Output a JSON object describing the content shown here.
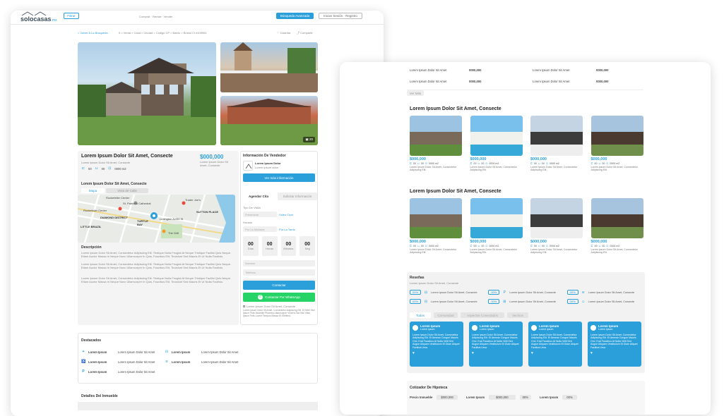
{
  "colors": {
    "accent": "#2b9fd9",
    "whatsapp": "#25d366",
    "background": "#ffffff"
  },
  "left": {
    "header": {
      "logo": "solocasas",
      "logo_suffix": ".mx",
      "filter_label": "Filtrar",
      "nav_links": "Comprar · Rentar · Vender",
      "advanced_search": "Búsqueda Avanzada",
      "login": "Iniciar Sesión - Registro"
    },
    "subnav": {
      "back": "< Volver A La Búsqueda",
      "breadcrumb": "0 > Venta > Casa > Ciudad > Código CP > Barrio > Bristol Ct #105981",
      "save": "Guardar",
      "share": "Compartir"
    },
    "photo_count": "20",
    "listing": {
      "title": "Lorem Ipsum Dolor Sit Amet, Consecte",
      "address": "Lorem Ipsum Dolor Sit Amet, Consecte",
      "price": "$000,000",
      "price_note": "Lorem Ipsum Dolor Sit Amet, Consecte",
      "features": [
        "00",
        "00",
        "0000 m2"
      ]
    },
    "map_section": {
      "title": "Lorem Ipsum Dolor Sit Amet, Consecte",
      "tab_map": "Mapa",
      "tab_street": "Vista de Calle",
      "labels": [
        "Rockefeller Center",
        "St. Patrick's Cathedral",
        "Trader Joe's",
        "SUTTON PLACE",
        "DIAMOND DISTRICT",
        "TURTLE BAY",
        "LITTLE BRAZIL",
        "Lexington Av/53 St",
        "The Grill",
        "Rockefeller Center"
      ]
    },
    "description": {
      "title": "Descripción",
      "paragraphs": [
        "Lorem Ipsum Dolor Sit Amet, Consectetur Adipiscing Elit. Tristique Nulla Feugiat At Neque Tristique Facilisi Quis Neque. Etiam Auctor Massa In Neque Nunc Ullamcorper In Quis, Faucibus Elit. Tincidunt Sed Mauris Et Ut Nulla Facilisis.",
        "Lorem Ipsum Dolor Sit Amet, Consectetur Adipiscing Elit. Tristique Nulla Feugiat At Neque Tristique Facilisi Quis Neque. Etiam Auctor Massa In Neque Nunc Ullamcorper In Quis, Faucibus Elit. Tincidunt Sed Mauris Et Ut Nulla Facilisis.",
        "Lorem Ipsum Dolor Sit Amet, Consectetur Adipiscing Elit. Tristique Nulla Feugiat At Neque Tristique Facilisi Quis Neque. Etiam Auctor Massa In Neque Nunc Ullamcorper In Quis, Faucibus Elit. Tincidunt Sed Mauris Et Ut Nulla Facilisis."
      ]
    },
    "seller": {
      "title": "Información De Vendedor",
      "name": "Lorem Ipsum Dolor",
      "subtitle": "Lorem ipsum dolor",
      "button": "Ver más información"
    },
    "schedule": {
      "tab_schedule": "Agendar Cita",
      "tab_info": "Solicitar Información",
      "type_label": "Tipo De Visita",
      "in_person": "Presencial",
      "video_call": "Video Chat",
      "schedule_label": "Horario",
      "morning": "Por La Mañana",
      "afternoon": "Por La Tarde",
      "counters": [
        {
          "value": "00",
          "label": "Días"
        },
        {
          "value": "00",
          "label": "Horas"
        },
        {
          "value": "00",
          "label": "Minutos"
        },
        {
          "value": "00",
          "label": "Seg"
        }
      ],
      "name_ph": "Nombre",
      "phone_ph": "Teléfono",
      "email_ph": "Email",
      "contact_button": "Contactar",
      "whatsapp_button": "Contactar Por WhatsApp",
      "consent": "Lorem Ipsum Dolor Sit Amet, Consecte",
      "legal": "Lorem Ipsum Dolor Sit Amet, Consectetur Adipiscing Elit. Et Nibh Sed Ipsum Felis Molestie Pharetra Ullamcorper Viverra Sed Nisi Vitae Ipsum Felis Lorem Tempus Massa Et Eleifend."
    },
    "highlights": {
      "title": "Destacados",
      "items": [
        {
          "label": "Lorem Ipsum",
          "value": "Lorem Ipsum Dolor Sit Amet",
          "label2": "Lorem Ipsum",
          "value2": "Lorem Ipsum Dolor Sit Amet"
        },
        {
          "label": "Lorem Ipsum",
          "value": "Lorem Ipsum Dolor Sit Amet",
          "label2": "Lorem Ipsum",
          "value2": "Lorem Ipsum Dolor Sit Amet"
        },
        {
          "label": "Lorem Ipsum",
          "value": "Lorem Ipsum Dolor Sit Amet",
          "label2": "",
          "value2": ""
        }
      ]
    },
    "details_title": "Detalles Del Inmueble"
  },
  "right": {
    "table": [
      [
        "Lorem Ipsum Dolor Sit Amet",
        "0000,000",
        "Lorem Ipsum Dolor Sit Amet",
        "0000,000"
      ],
      [
        "Lorem Ipsum Dolor Sit Amet",
        "0000,000",
        "Lorem Ipsum Dolor Sit Amet",
        "0000,000"
      ]
    ],
    "see_more": "Ver Más",
    "section1_title": "Lorem Ipsum Dolor Sit Amet, Consecte",
    "section2_title": "Lorem Ipsum Dolor Sit Amet, Consecte",
    "listing": {
      "price": "$000,000",
      "features": [
        "00",
        "00",
        "0000 m2"
      ],
      "desc": "Lorem Ipsum Dolor Sit Amet, Consectetur Adipiscing Elit."
    },
    "reviews": {
      "title": "Reseñas",
      "subtitle": "Lorem Ipsum Dolor Sit Amet, Consecte",
      "pct": "00%",
      "item": "Lorem Ipsum Dolor Sit Amet, Consecte",
      "tabs": [
        "Todos",
        "Comunidad",
        "Aspectos Conectados",
        "Vecinos"
      ],
      "card_name": "Lorem Ipsum",
      "card_sub": "Lorem Ipsum",
      "card_text": "Lorem Ipsum Dolor Sit Amet, Consectetur Adipiscing Elit. Et Aenean Congue Mauris Orci. Erat Faucibus At Nulla Velit Sed Augue Aliquam Vestibulum Et Diam Aliquet Facilisis Urna."
    },
    "mortgage": {
      "title": "Cotizador De Hipoteca",
      "price_label": "Precio Inmueble",
      "price_value": "$000,000",
      "f1_label": "Lorem Ipsum",
      "f1_value": "$000,000",
      "f1_pct": "00%",
      "f2_label": "Lorem Ipsum",
      "f2_pct": "00%"
    }
  }
}
